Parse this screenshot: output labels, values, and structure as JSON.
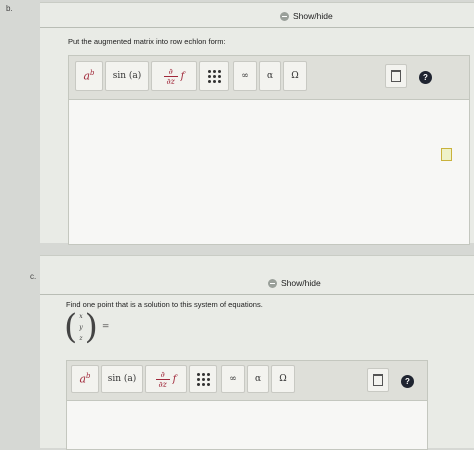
{
  "part_b": {
    "label": "b.",
    "show_hide": "Show/hide",
    "prompt": "Put the augmented matrix into row echlon form:"
  },
  "part_c": {
    "label": "c.",
    "show_hide": "Show/hide",
    "prompt": "Find one point that is a solution to this system of equations.",
    "vector": {
      "entries": [
        "x",
        "y",
        "z"
      ],
      "equals": "="
    }
  },
  "toolbar": {
    "superscript": {
      "base": "a",
      "exp": "b"
    },
    "sin_label": "sin (a)",
    "derivative": {
      "num": "∂",
      "den": "∂z",
      "fn": "f"
    },
    "infinity": "∞",
    "alpha": "α",
    "omega": "Ω",
    "help": "?"
  },
  "colors": {
    "accent": "#a0283a",
    "help_button": "#1f2430",
    "background": "#d6d8d4"
  }
}
